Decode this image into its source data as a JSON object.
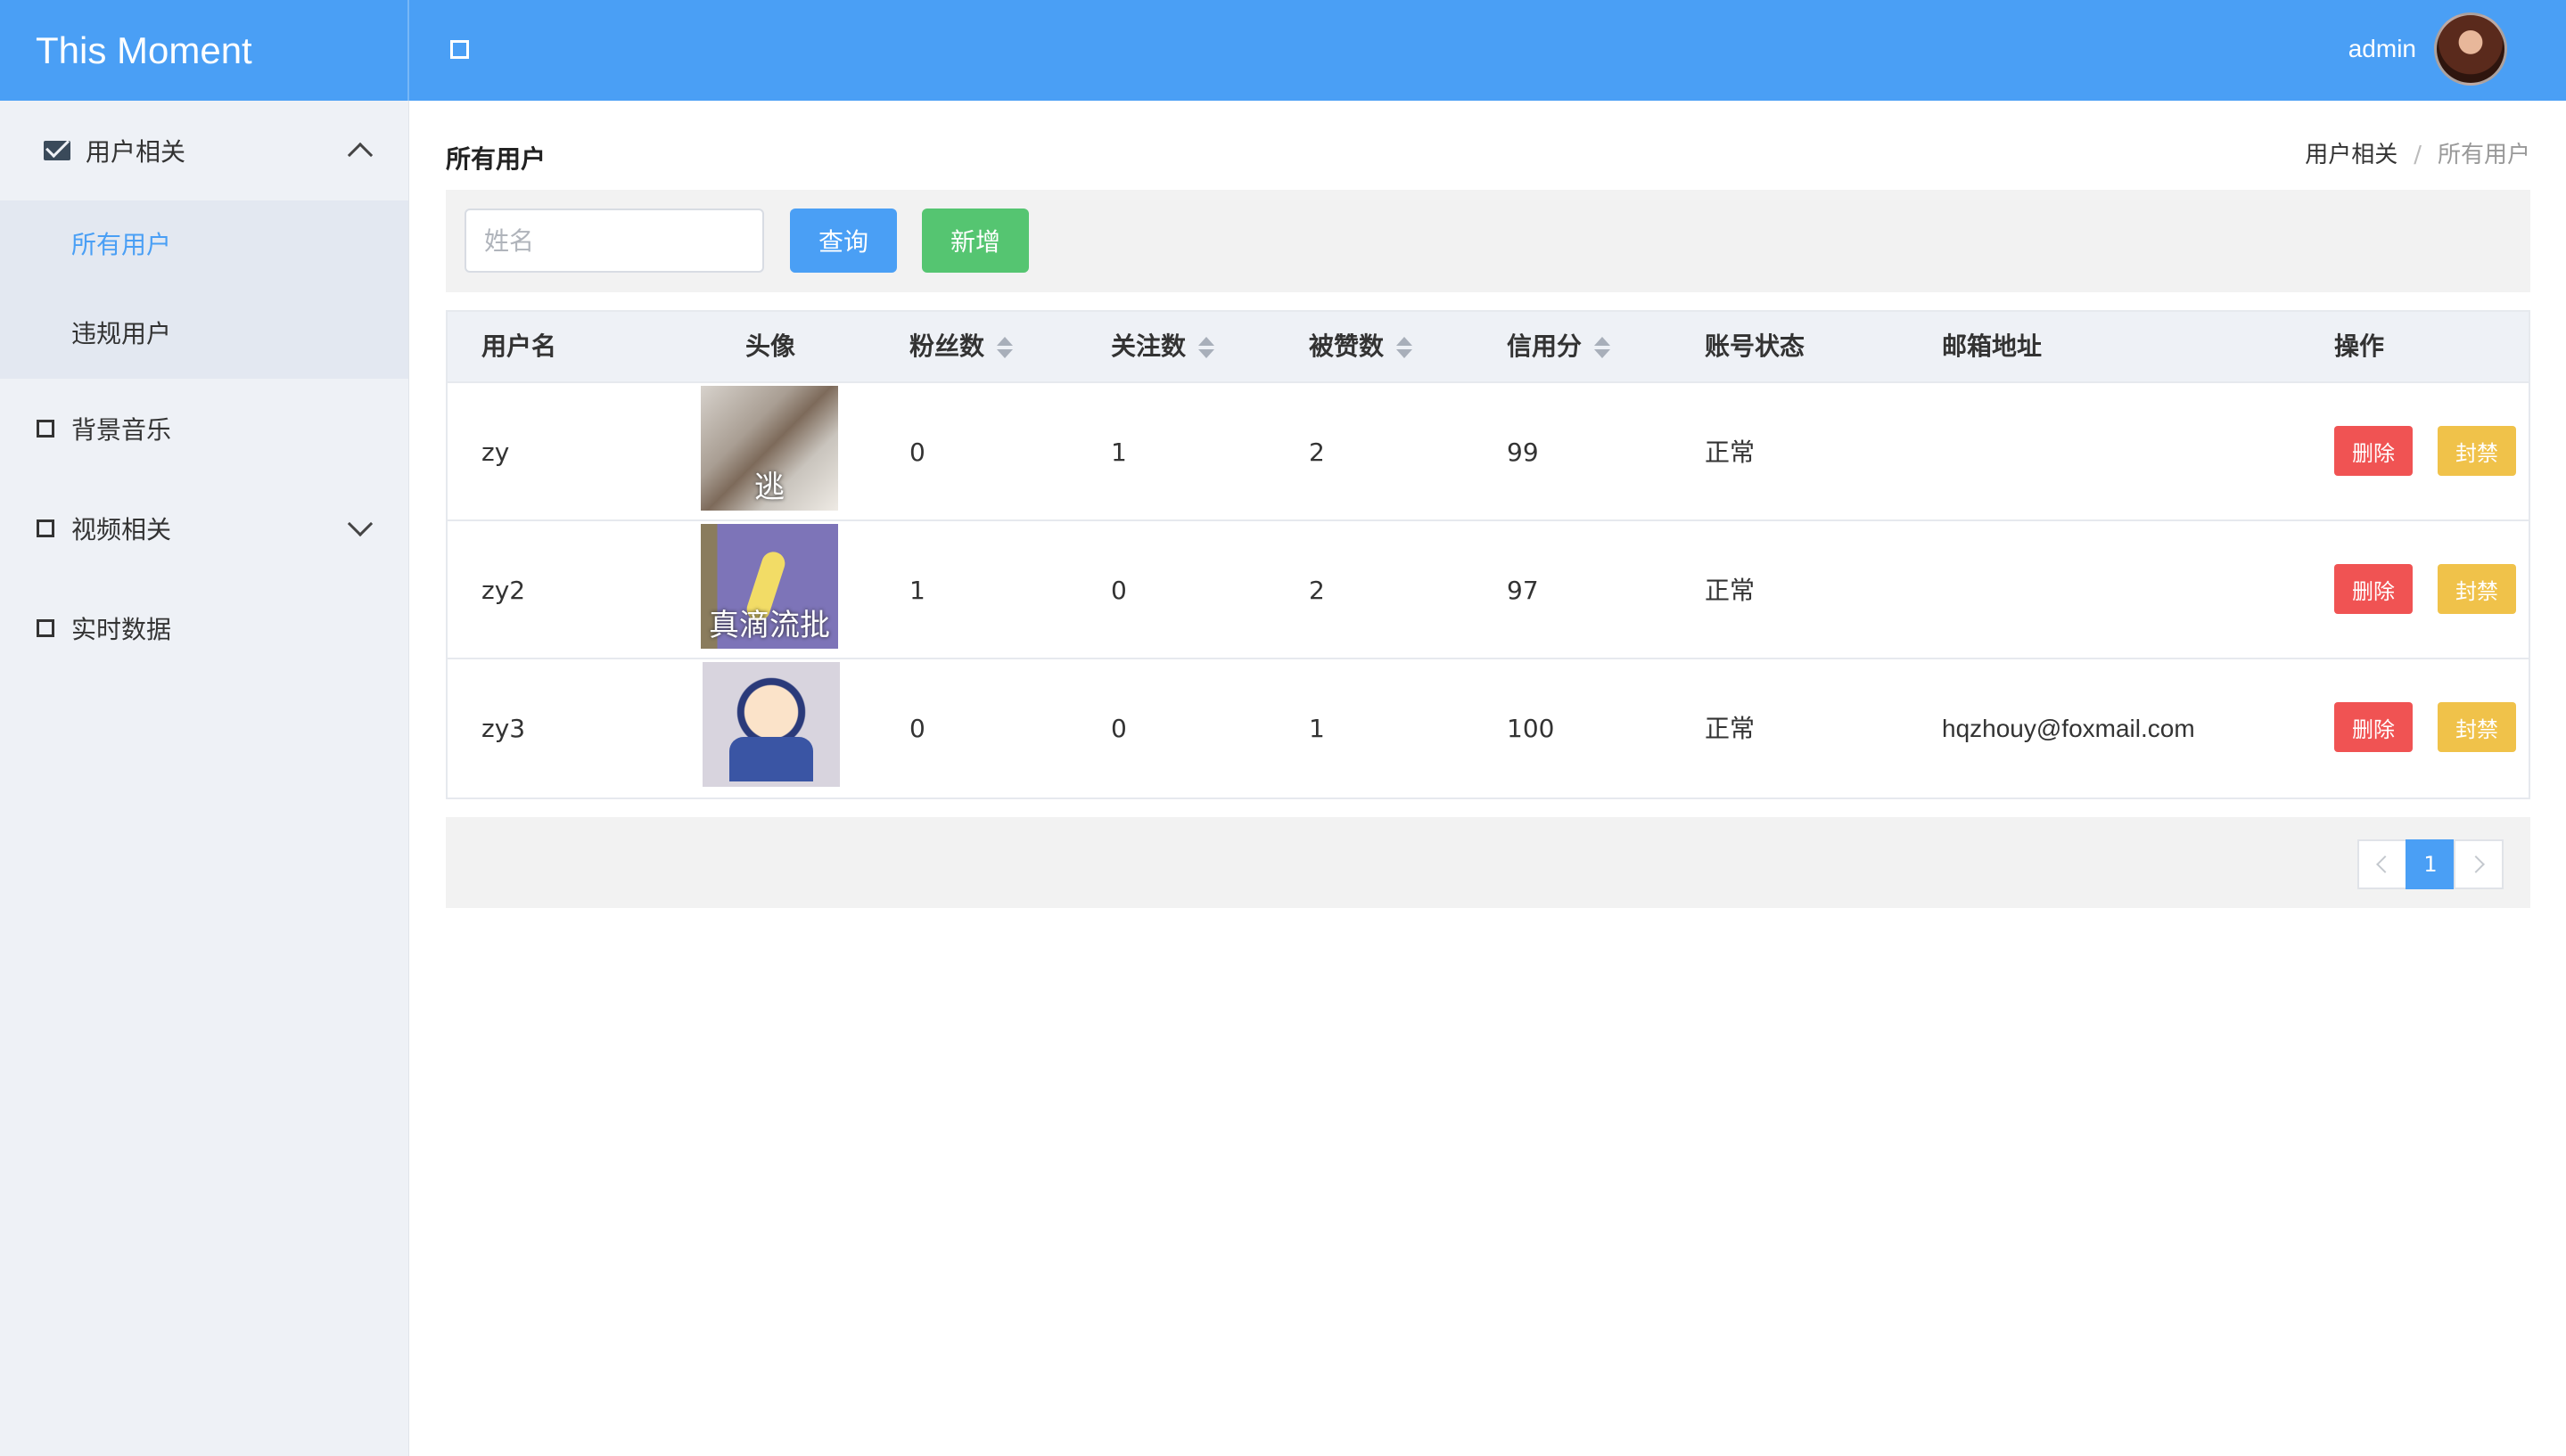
{
  "app": {
    "title": "This Moment"
  },
  "header": {
    "username": "admin"
  },
  "sidebar": {
    "groups": [
      {
        "label": "用户相关",
        "icon": "envelope-icon",
        "expanded": true,
        "items": [
          {
            "label": "所有用户",
            "active": true
          },
          {
            "label": "违规用户",
            "active": false
          }
        ]
      },
      {
        "label": "背景音乐",
        "icon": "square-icon"
      },
      {
        "label": "视频相关",
        "icon": "square-icon",
        "expanded": false
      },
      {
        "label": "实时数据",
        "icon": "square-icon"
      }
    ]
  },
  "page": {
    "title": "所有用户",
    "breadcrumb": [
      "用户相关",
      "所有用户"
    ]
  },
  "toolbar": {
    "search_placeholder": "姓名",
    "query_label": "查询",
    "add_label": "新增"
  },
  "table": {
    "columns": [
      "用户名",
      "头像",
      "粉丝数",
      "关注数",
      "被赞数",
      "信用分",
      "账号状态",
      "邮箱地址",
      "操作"
    ],
    "rows": [
      {
        "username": "zy",
        "avatar_caption": "逃",
        "fans": "0",
        "follows": "1",
        "likes": "2",
        "credit": "99",
        "status": "正常",
        "email": ""
      },
      {
        "username": "zy2",
        "avatar_caption": "真滴流批",
        "fans": "1",
        "follows": "0",
        "likes": "2",
        "credit": "97",
        "status": "正常",
        "email": ""
      },
      {
        "username": "zy3",
        "avatar_caption": "",
        "fans": "0",
        "follows": "0",
        "likes": "1",
        "credit": "100",
        "status": "正常",
        "email": "hqzhouy@foxmail.com"
      }
    ],
    "delete_label": "删除",
    "ban_label": "封禁"
  },
  "pagination": {
    "current_page": "1"
  },
  "colors": {
    "primary": "#4a9ff5",
    "success": "#55c571",
    "danger": "#f05353",
    "warning": "#f0c24a",
    "sidebar_bg": "#eef1f6"
  }
}
